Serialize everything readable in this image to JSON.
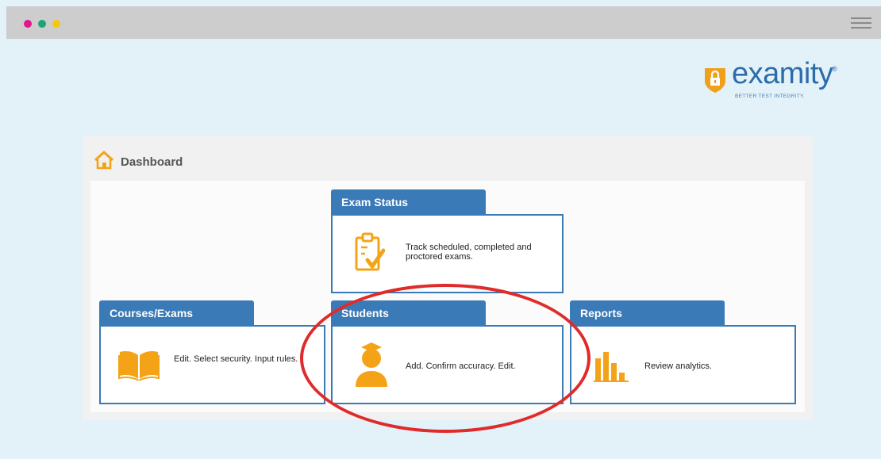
{
  "window": {
    "dot_colors": [
      "#e3168f",
      "#1aa67a",
      "#f5c80b"
    ]
  },
  "brand": {
    "name": "examity",
    "registered_mark": "®",
    "tagline": "BETTER TEST INTEGRITY.",
    "color": "#2d6cab",
    "shield_color": "#f0a11b"
  },
  "dashboard": {
    "title": "Dashboard",
    "cards": [
      {
        "id": "exam-status",
        "title": "Exam Status",
        "description": "Track scheduled, completed and proctored exams.",
        "icon": "clipboard-check-icon"
      },
      {
        "id": "courses-exams",
        "title": "Courses/Exams",
        "description": "Edit. Select security. Input rules.",
        "icon": "open-book-icon"
      },
      {
        "id": "students",
        "title": "Students",
        "description": "Add. Confirm accuracy. Edit.",
        "icon": "student-graduate-icon"
      },
      {
        "id": "reports",
        "title": "Reports",
        "description": "Review analytics.",
        "icon": "bar-chart-icon"
      }
    ],
    "accent_color": "#3a7ab6",
    "icon_color": "#f5a316",
    "highlight_color": "#e02b2b"
  }
}
